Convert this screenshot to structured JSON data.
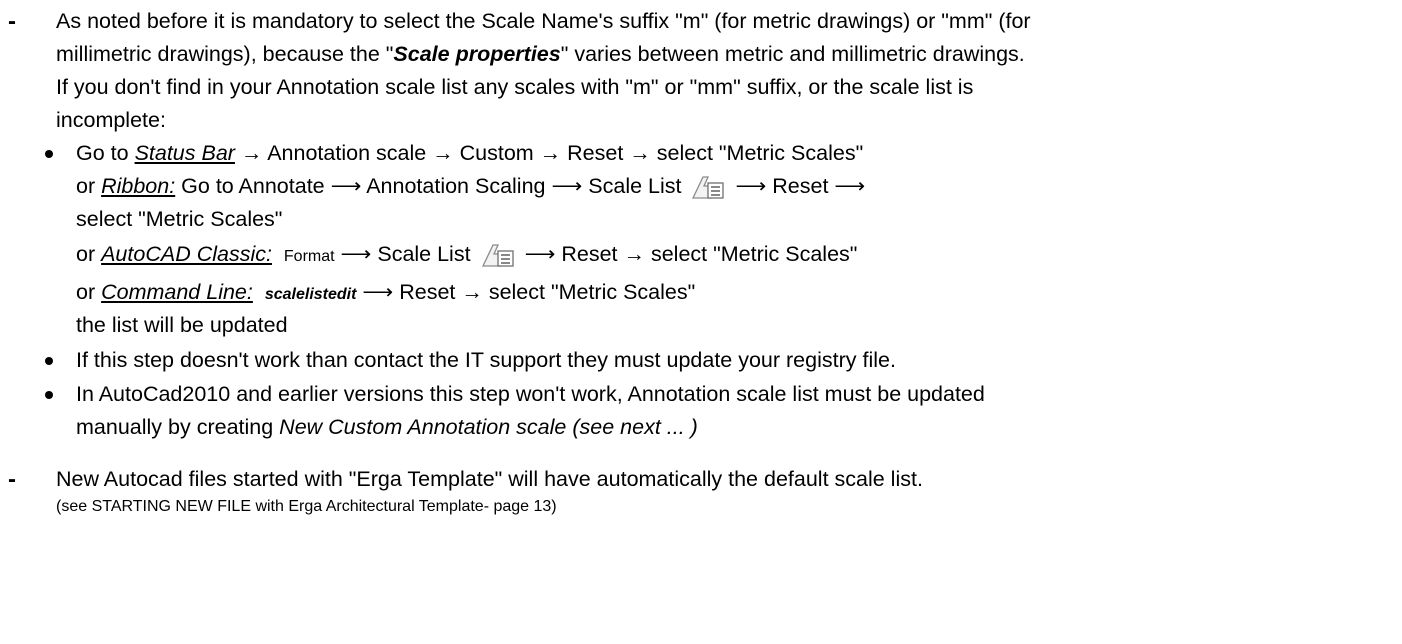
{
  "p1": {
    "dash": "-",
    "l1": "As noted before it is mandatory to select the Scale Name's suffix \"m\" (for metric drawings) or \"mm\" (for",
    "l2a": "millimetric drawings), because  the \"",
    "l2b": "Scale properties",
    "l2c": "\"  varies between metric and millimetric drawings.",
    "l3": "If you don't find in your Annotation scale list any scales with \"m\" or \"mm\" suffix, or the scale list is",
    "l4": "incomplete:"
  },
  "b1": {
    "l1a": "Go to ",
    "l1b": "Status Bar",
    "l1c": " → Annotation scale → Custom → Reset → select \"Metric Scales\"",
    "l2a": "or ",
    "l2b": "Ribbon:",
    "l2c": " Go to Annotate ⟶ Annotation Scaling ⟶ Scale List",
    "l2d": "⟶ Reset ⟶",
    "l3": "select \"Metric Scales\"",
    "l4a": "or ",
    "l4b": "AutoCAD Classic:",
    "l4c": "Format",
    "l4d": " ⟶ Scale List",
    "l4e": "⟶ Reset → select \"Metric Scales\"",
    "l5a": "or ",
    "l5b": "Command Line:",
    "l5c": "scalelistedit",
    "l5d": " ⟶ Reset → select \"Metric Scales\"",
    "l6": "the list will be updated"
  },
  "b2": {
    "l1": "If this step doesn't work than contact the IT support they must update your registry file."
  },
  "b3": {
    "l1": "In  AutoCad2010 and earlier versions this step won't work, Annotation scale list must be updated",
    "l2a": "manually by creating ",
    "l2b": "New Custom Annotation scale (see next ... )"
  },
  "p2": {
    "dash": "-",
    "l1": "New Autocad files started with \"Erga Template\" will have automatically the default scale list.",
    "l2": "(see STARTING NEW FILE with Erga Architectural Template- page 13)"
  },
  "icons": {
    "scale_list": "scale-list-icon"
  }
}
